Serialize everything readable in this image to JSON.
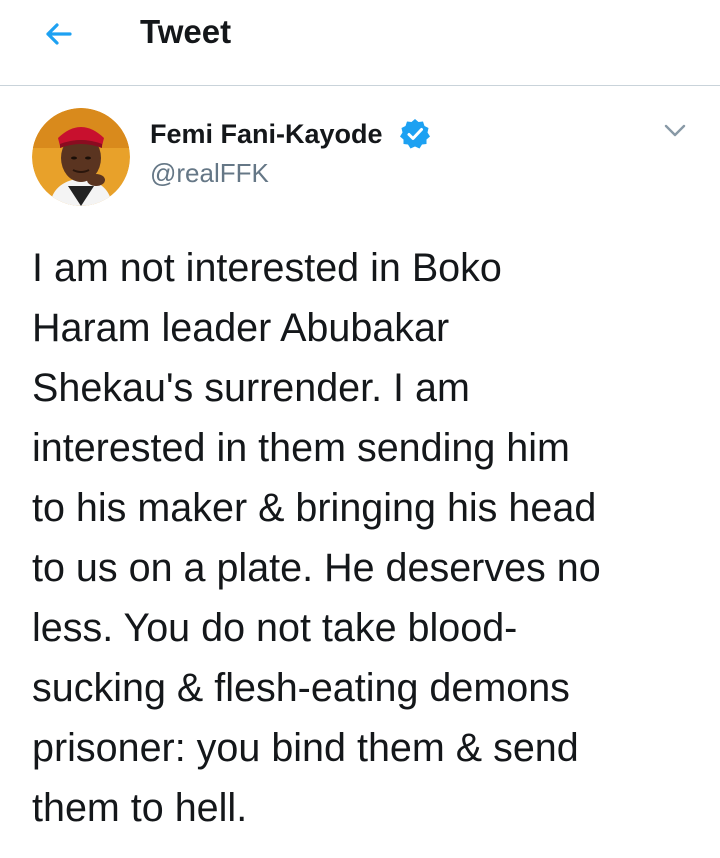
{
  "header": {
    "back_icon": "back-arrow-icon",
    "title": "Tweet"
  },
  "author": {
    "display_name": "Femi Fani-Kayode",
    "handle": "@realFFK",
    "verified": true,
    "verified_icon": "verified-badge-icon"
  },
  "tweet": {
    "text": "I am not interested in Boko\nHaram leader Abubakar\nShekau's surrender. I am\ninterested in them sending him\nto his maker & bringing his head\nto us on a plate. He deserves no\nless. You do not take blood-\nsucking & flesh-eating demons\nprisoner: you bind them & send\nthem to hell."
  },
  "menu": {
    "icon": "chevron-down-icon"
  },
  "colors": {
    "accent": "#1da1f2",
    "text": "#14171a",
    "secondary_text": "#657786",
    "divider": "#c9d3da"
  }
}
